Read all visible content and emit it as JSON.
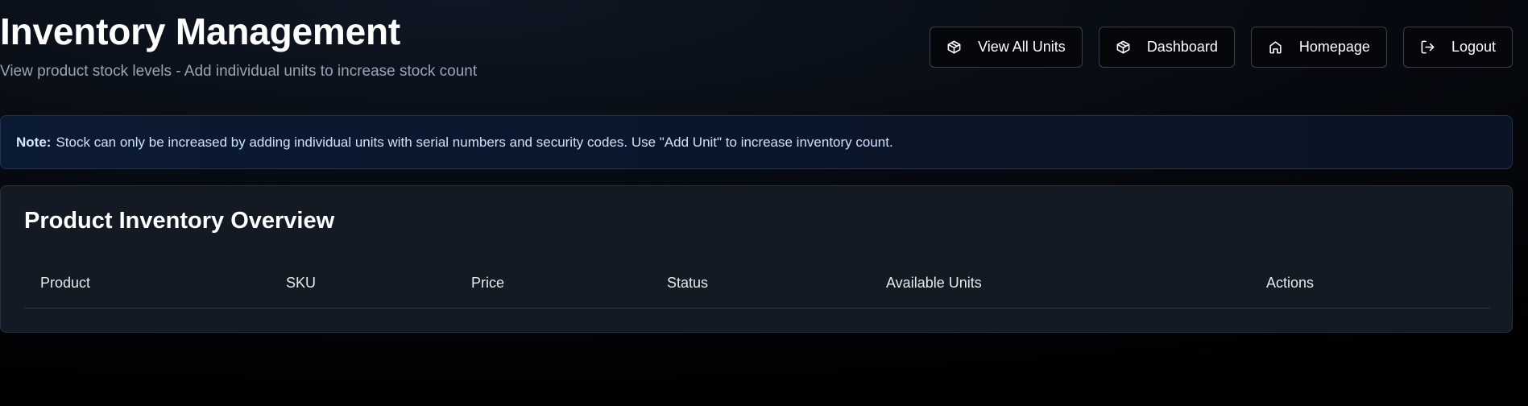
{
  "header": {
    "title": "Inventory Management",
    "subtitle": "View product stock levels - Add individual units to increase stock count"
  },
  "nav": [
    {
      "label": "View All Units",
      "icon": "package-icon"
    },
    {
      "label": "Dashboard",
      "icon": "package-icon"
    },
    {
      "label": "Homepage",
      "icon": "home-icon"
    },
    {
      "label": "Logout",
      "icon": "logout-icon"
    }
  ],
  "note": {
    "label": "Note:",
    "text": "Stock can only be increased by adding individual units with serial numbers and security codes. Use \"Add Unit\" to increase inventory count."
  },
  "inventory": {
    "title": "Product Inventory Overview",
    "columns": [
      "Product",
      "SKU",
      "Price",
      "Status",
      "Available Units",
      "Actions"
    ],
    "rows": []
  },
  "colors": {
    "background": "#000000",
    "card": "#141a23",
    "note_bg": "#0b1a33",
    "note_border": "#1e3558",
    "subtitle": "#9aa3b2"
  }
}
